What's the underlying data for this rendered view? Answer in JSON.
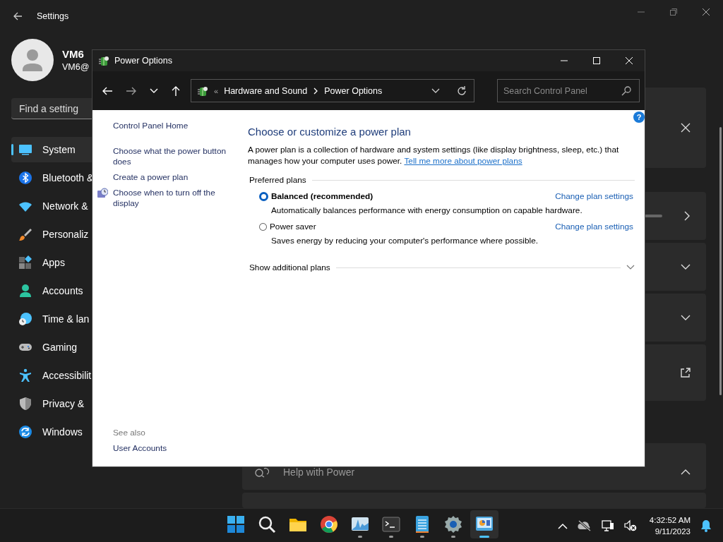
{
  "settings": {
    "title": "Settings",
    "user": {
      "name": "VM6",
      "email": "VM6@"
    },
    "search": {
      "placeholder": "Find a setting"
    },
    "nav": [
      {
        "label": "System",
        "selected": true
      },
      {
        "label": "Bluetooth &",
        "selected": false
      },
      {
        "label": "Network &",
        "selected": false
      },
      {
        "label": "Personaliz",
        "selected": false
      },
      {
        "label": "Apps",
        "selected": false
      },
      {
        "label": "Accounts",
        "selected": false
      },
      {
        "label": "Time & lan",
        "selected": false
      },
      {
        "label": "Gaming",
        "selected": false
      },
      {
        "label": "Accessibilit",
        "selected": false
      },
      {
        "label": "Privacy &",
        "selected": false
      },
      {
        "label": "Windows",
        "selected": false
      }
    ],
    "help_card": {
      "label": "Help with Power",
      "expanded": true
    }
  },
  "dialog": {
    "title": "Power Options",
    "address": {
      "overflow": "«",
      "path": [
        "Hardware and Sound",
        "Power Options"
      ]
    },
    "search": {
      "placeholder": "Search Control Panel"
    },
    "help": "?",
    "tasks": [
      {
        "label": "Control Panel Home",
        "has_icon": false
      },
      {
        "label": "Choose what the power button does",
        "has_icon": false
      },
      {
        "label": "Create a power plan",
        "has_icon": false
      },
      {
        "label": "Choose when to turn off the display",
        "has_icon": true
      }
    ],
    "see_also": {
      "heading": "See also",
      "links": [
        "User Accounts"
      ]
    },
    "heading": "Choose or customize a power plan",
    "description": "A power plan is a collection of hardware and system settings (like display brightness, sleep, etc.) that manages how your computer uses power.",
    "description_link": "Tell me more about power plans",
    "group_label": "Preferred plans",
    "plans": [
      {
        "name": "Balanced (recommended)",
        "selected": true,
        "description": "Automatically balances performance with energy consumption on capable hardware.",
        "action": "Change plan settings"
      },
      {
        "name": "Power saver",
        "selected": false,
        "description": "Saves energy by reducing your computer's performance where possible.",
        "action": "Change plan settings"
      }
    ],
    "more_plans": {
      "label": "Show additional plans",
      "expanded": false
    }
  },
  "taskbar": {
    "apps": [
      {
        "running": false,
        "selected": false
      },
      {
        "running": false,
        "selected": false
      },
      {
        "running": false,
        "selected": false
      },
      {
        "running": false,
        "selected": false
      },
      {
        "running": true,
        "selected": false
      },
      {
        "running": true,
        "selected": false
      },
      {
        "running": true,
        "selected": false
      },
      {
        "running": true,
        "selected": false
      },
      {
        "running": true,
        "selected": true
      }
    ],
    "time": "4:32:52 AM",
    "date": "9/11/2023"
  }
}
